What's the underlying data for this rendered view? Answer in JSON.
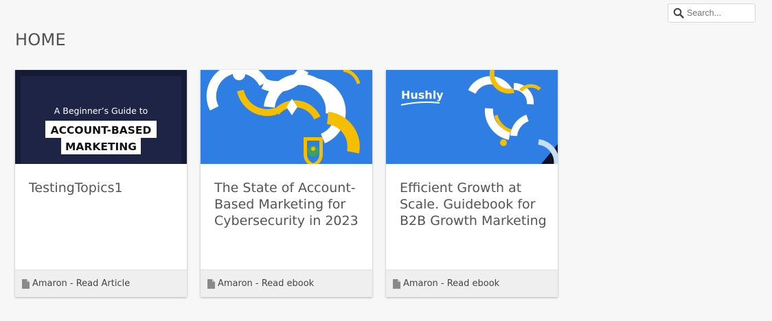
{
  "search": {
    "placeholder": "Search..."
  },
  "page": {
    "title": "HOME"
  },
  "cards": [
    {
      "title": "TestingTopics1",
      "meta": "Amaron - Read Article",
      "image": {
        "line1": "A Beginner’s Guide to",
        "line2": "ACCOUNT-BASED",
        "line3": "MARKETING",
        "colors": {
          "bg": "#1a1f3d",
          "inner": "#1f2545"
        }
      }
    },
    {
      "title": "The State of Account-Based Marketing for Cybersecurity in 2023",
      "meta": "Amaron - Read ebook",
      "image": {
        "colors": {
          "bg": "#2f7ee3",
          "accent": "#f5be00"
        }
      }
    },
    {
      "title": "Efficient Growth at Scale. Guidebook for B2B Growth Marketing",
      "meta": "Amaron - Read ebook",
      "image": {
        "logo": "Hushly",
        "colors": {
          "bg": "#2f7ee3",
          "accent": "#f5be00"
        }
      }
    }
  ]
}
